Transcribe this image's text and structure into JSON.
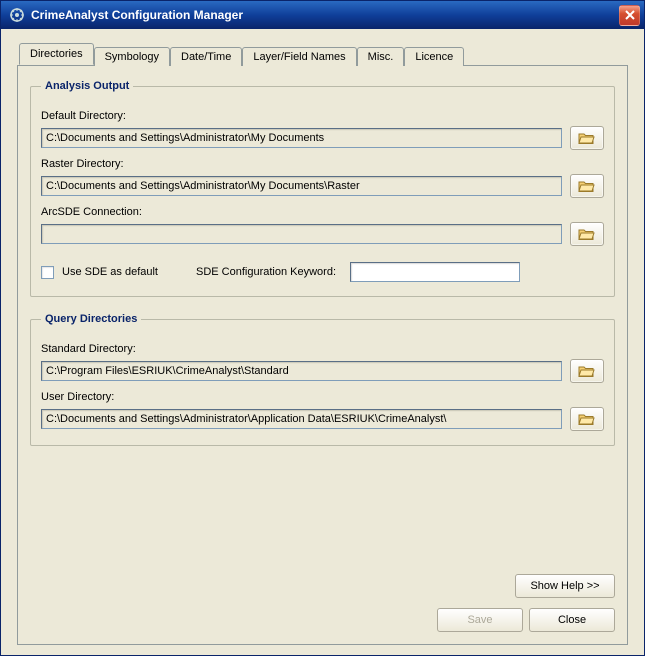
{
  "window": {
    "title": "CrimeAnalyst Configuration Manager"
  },
  "tabs": [
    {
      "label": "Directories"
    },
    {
      "label": "Symbology"
    },
    {
      "label": "Date/Time"
    },
    {
      "label": "Layer/Field Names"
    },
    {
      "label": "Misc."
    },
    {
      "label": "Licence"
    }
  ],
  "analysisOutput": {
    "legend": "Analysis Output",
    "defaultDirLabel": "Default Directory:",
    "defaultDirValue": "C:\\Documents and Settings\\Administrator\\My Documents",
    "rasterDirLabel": "Raster Directory:",
    "rasterDirValue": "C:\\Documents and Settings\\Administrator\\My Documents\\Raster",
    "arcsdeLabel": "ArcSDE Connection:",
    "arcsdeValue": "",
    "useSdeLabel": "Use SDE as default",
    "sdeKeywordLabel": "SDE Configuration Keyword:",
    "sdeKeywordValue": ""
  },
  "queryDirs": {
    "legend": "Query Directories",
    "standardDirLabel": "Standard Directory:",
    "standardDirValue": "C:\\Program Files\\ESRIUK\\CrimeAnalyst\\Standard",
    "userDirLabel": "User Directory:",
    "userDirValue": "C:\\Documents and Settings\\Administrator\\Application Data\\ESRIUK\\CrimeAnalyst\\"
  },
  "buttons": {
    "showHelp": "Show Help >>",
    "save": "Save",
    "close": "Close"
  }
}
